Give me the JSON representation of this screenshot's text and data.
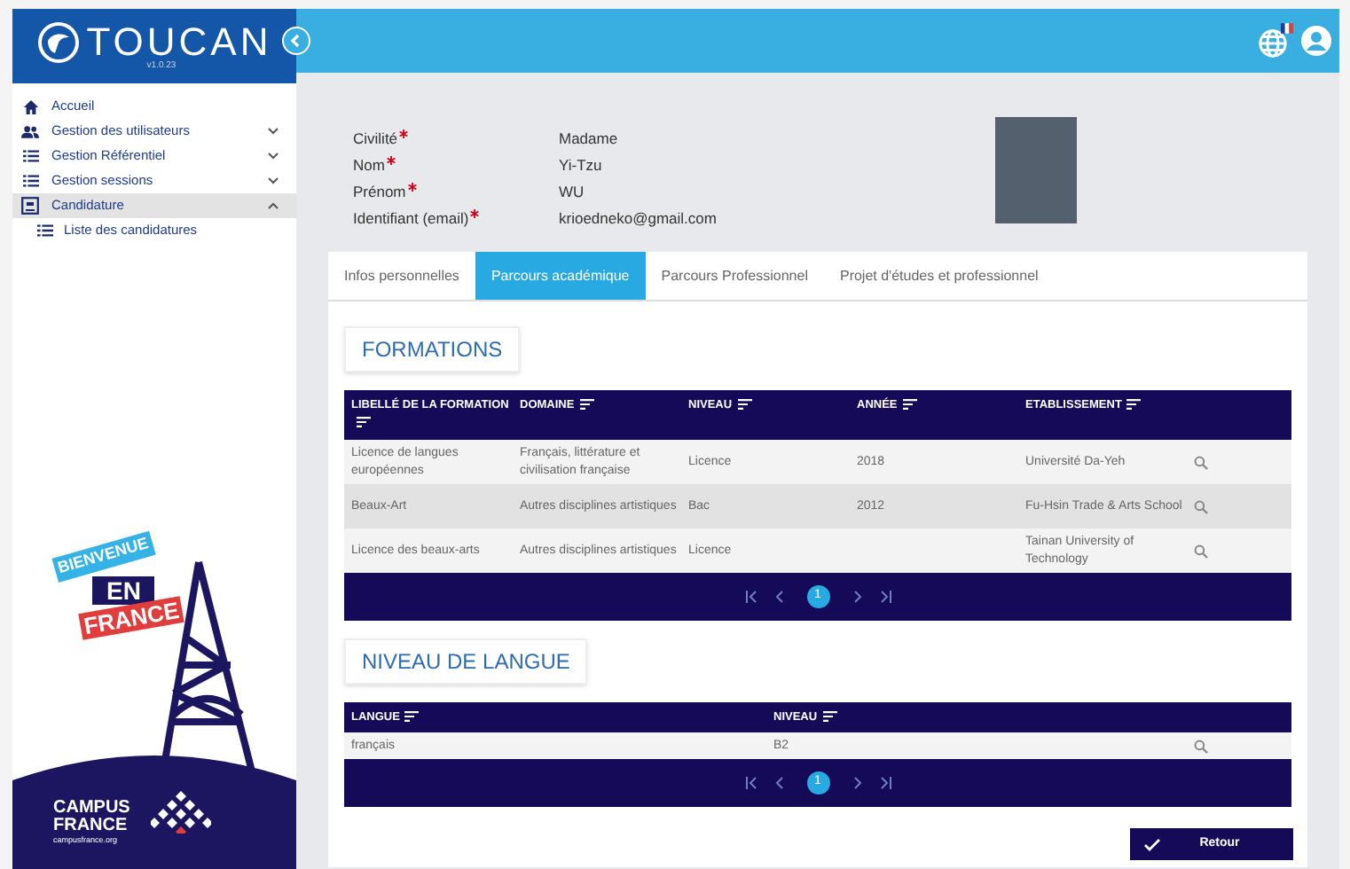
{
  "app": {
    "name": "TOUCAN",
    "version": "v1.0.23"
  },
  "sidebar": {
    "items": [
      {
        "label": "Accueil",
        "selected": false
      },
      {
        "label": "Gestion des utilisateurs",
        "expanded": false,
        "selected": false
      },
      {
        "label": "Gestion Référentiel",
        "expanded": false,
        "selected": false
      },
      {
        "label": "Gestion sessions",
        "expanded": false,
        "selected": false
      },
      {
        "label": "Candidature",
        "expanded": true,
        "selected": true,
        "children": [
          {
            "label": "Liste des candidatures"
          }
        ]
      }
    ]
  },
  "banner": {
    "lines": [
      "BIENVENUE",
      "EN",
      "FRANCE"
    ],
    "brand": [
      "CAMPUS",
      "FRANCE"
    ],
    "url": "campusfrance.org"
  },
  "profile": {
    "fields": [
      {
        "label": "Civilité",
        "required": true,
        "value": "Madame"
      },
      {
        "label": "Nom",
        "required": true,
        "value": "Yi-Tzu"
      },
      {
        "label": "Prénom",
        "required": true,
        "value": "WU"
      },
      {
        "label": "Identifiant (email)",
        "required": true,
        "value": "krioedneko@gmail.com"
      }
    ]
  },
  "tabs": [
    {
      "label": "Infos personnelles",
      "selected": false
    },
    {
      "label": "Parcours académique",
      "selected": true
    },
    {
      "label": "Parcours Professionnel",
      "selected": false
    },
    {
      "label": "Projet d'études et professionnel",
      "selected": false
    }
  ],
  "formations": {
    "title": "FORMATIONS",
    "columns": [
      "LIBELLÉ DE LA FORMATION",
      "DOMAINE",
      "NIVEAU",
      "ANNÉE",
      "ETABLISSEMENT"
    ],
    "rows": [
      [
        "Licence de langues européennes",
        "Français, littérature et civilisation française",
        "Licence",
        "2018",
        "Université Da-Yeh"
      ],
      [
        "Beaux-Art",
        "Autres disciplines artistiques",
        "Bac",
        "2012",
        "Fu-Hsin Trade & Arts School"
      ],
      [
        "Licence des beaux-arts",
        "Autres disciplines artistiques",
        "Licence",
        "",
        "Tainan University of Technology"
      ]
    ],
    "page": "1"
  },
  "langues": {
    "title": "NIVEAU DE LANGUE",
    "columns": [
      "LANGUE",
      "NIVEAU"
    ],
    "rows": [
      [
        "français",
        "B2"
      ]
    ],
    "page": "1"
  },
  "actions": [
    {
      "label": "Retour"
    }
  ]
}
